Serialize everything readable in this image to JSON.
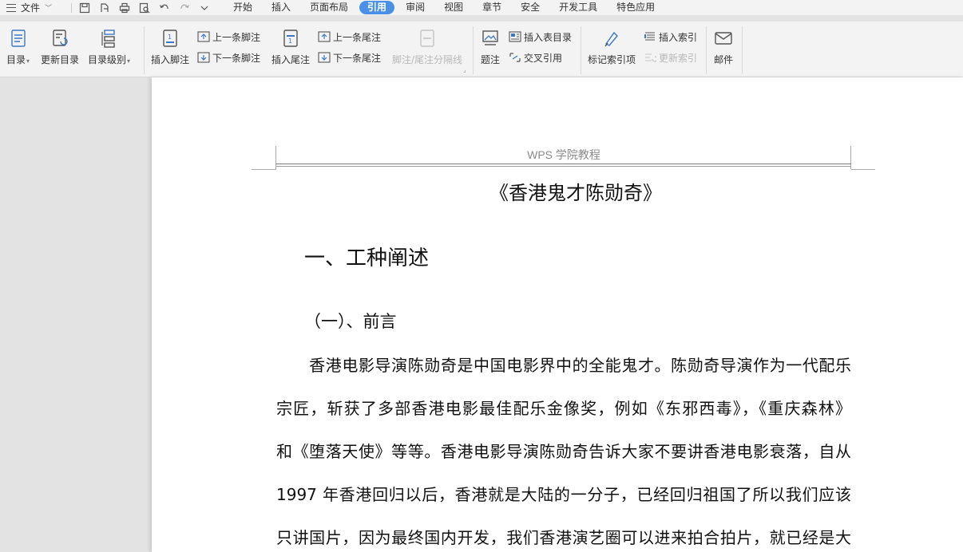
{
  "menubar": {
    "file_label": "文件",
    "tabs": [
      "开始",
      "插入",
      "页面布局",
      "引用",
      "审阅",
      "视图",
      "章节",
      "安全",
      "开发工具",
      "特色应用"
    ],
    "active_tab": "引用",
    "accent_color": "#4a90e8"
  },
  "ribbon": {
    "toc": "目录",
    "update_toc": "更新目录",
    "toc_level": "目录级别",
    "insert_footnote": "插入脚注",
    "prev_footnote": "上一条脚注",
    "next_footnote": "下一条脚注",
    "insert_endnote": "插入尾注",
    "prev_endnote": "上一条尾注",
    "next_endnote": "下一条尾注",
    "footnote_separator": "脚注/尾注分隔线",
    "caption": "题注",
    "insert_table_of_figures": "插入表目录",
    "cross_reference": "交叉引用",
    "mark_index_entry": "标记索引项",
    "insert_index": "插入索引",
    "update_index": "更新索引",
    "mail": "邮件"
  },
  "document": {
    "header": "WPS 学院教程",
    "title": "《香港鬼才陈勋奇》",
    "heading1": "一、工种阐述",
    "heading2": "（一）、前言",
    "lines": [
      "　　香港电影导演陈勋奇是中国电影界中的全能鬼才。陈勋奇导演作为一代配乐",
      "宗匠，斩获了多部香港电影最佳配乐金像奖，例如《东邪西毒》，《重庆森林》",
      "和《堕落天使》等等。香港电影导演陈勋奇告诉大家不要讲香港电影衰落，自从",
      "1997 年香港回归以后，香港就是大陆的一分子，已经回归祖国了所以我们应该",
      "只讲国片，因为最终国内开发，我们香港演艺圈可以进来拍合拍片，就已经是大"
    ]
  }
}
